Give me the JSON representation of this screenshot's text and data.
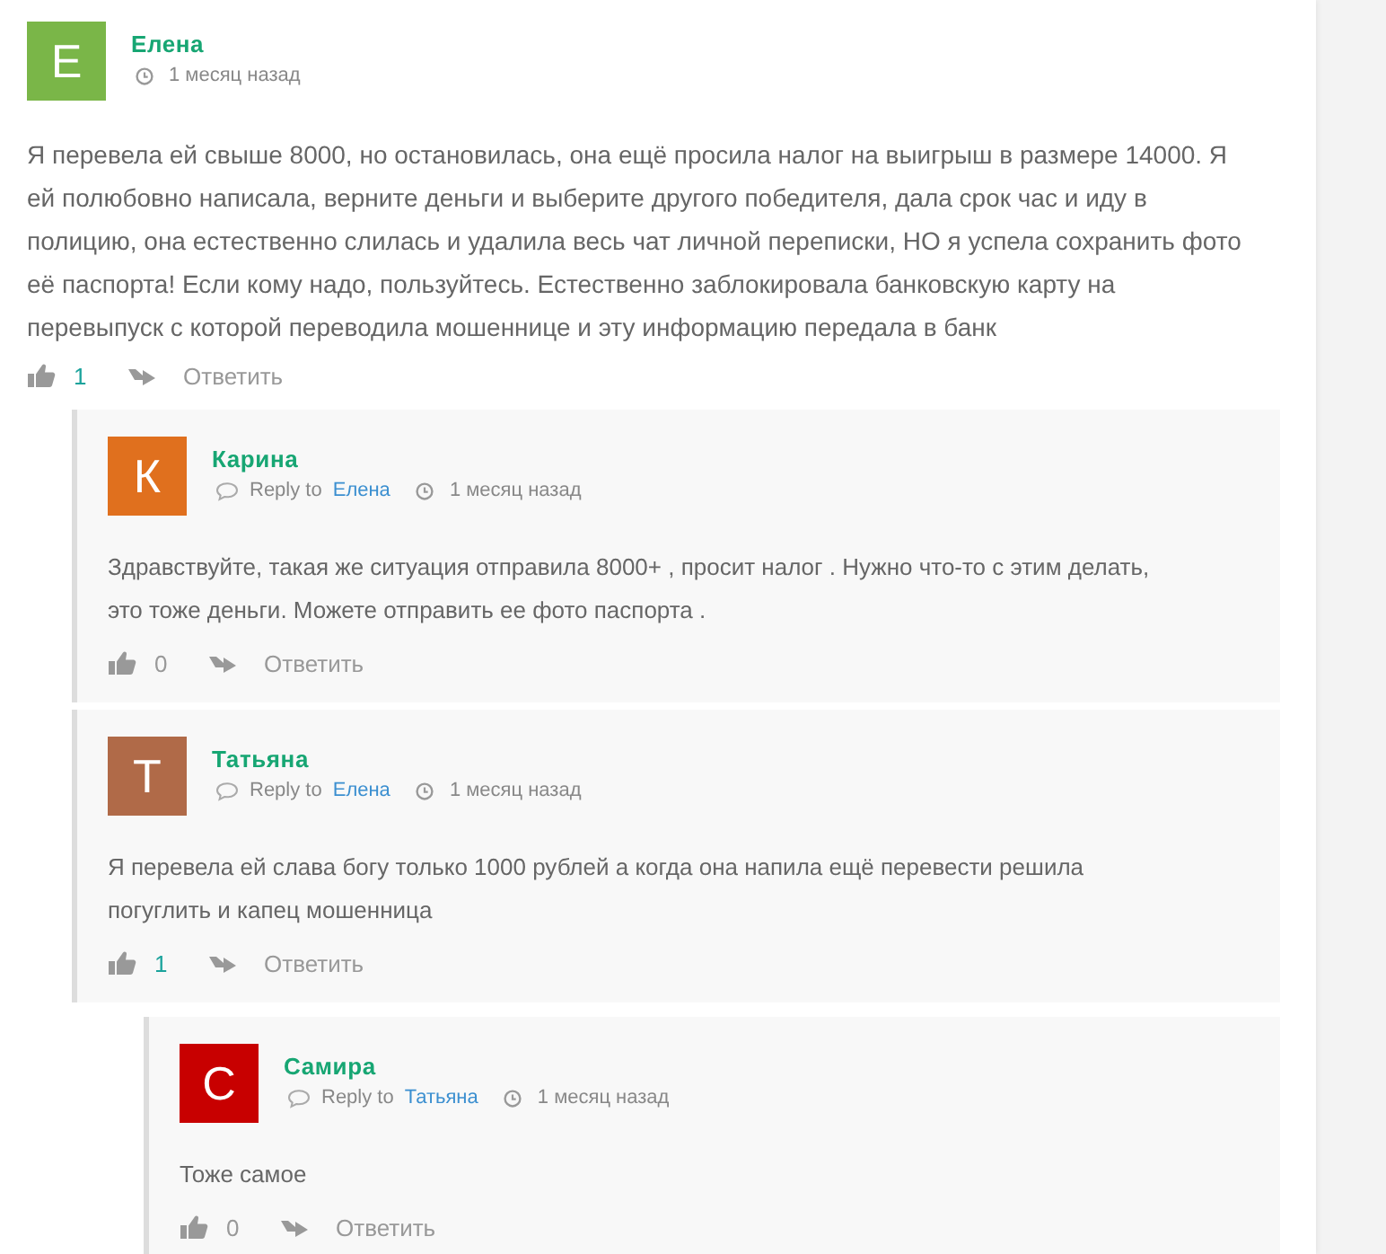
{
  "comments": [
    {
      "initial": "Е",
      "color": "#7ab648",
      "author": "Елена",
      "time": "1 месяц назад",
      "text": "Я перевела ей свыше 8000, но остановилась, она ещё просила налог на выигрыш в размере 14000. Я ей полюбовно написала, верните деньги и выберите другого победителя, дала срок час и иду в полицию, она естественно слилась и удалила весь чат личной переписки, НО я успела сохранить фото её паспорта! Если кому надо, пользуйтесь. Естественно заблокировала банковскую карту на перевыпуск с которой переводила мошеннице и эту информацию передала в банк",
      "likes": "1",
      "liked": true,
      "reply": "Ответить",
      "children": [
        {
          "initial": "К",
          "color": "#e0701e",
          "author": "Карина",
          "reply_prefix": "Reply to",
          "reply_to": "Елена",
          "time": "1 месяц назад",
          "text": "Здравствуйте, такая же ситуация отправила 8000+ , просит налог . Нужно что-то с этим делать, это тоже деньги. Можете отправить ее фото паспорта .",
          "likes": "0",
          "liked": false,
          "reply": "Ответить"
        },
        {
          "initial": "Т",
          "color": "#b06a48",
          "author": "Татьяна",
          "reply_prefix": "Reply to",
          "reply_to": "Елена",
          "time": "1 месяц назад",
          "text": "Я перевела ей слава богу только 1000 рублей а когда она напила ещё перевести решила погуглить и капец мошенница",
          "likes": "1",
          "liked": true,
          "reply": "Ответить",
          "children": [
            {
              "initial": "С",
              "color": "#c80000",
              "author": "Самира",
              "reply_prefix": "Reply to",
              "reply_to": "Татьяна",
              "time": "1 месяц назад",
              "text": "Тоже самое",
              "likes": "0",
              "liked": false,
              "reply": "Ответить"
            }
          ]
        }
      ]
    }
  ]
}
